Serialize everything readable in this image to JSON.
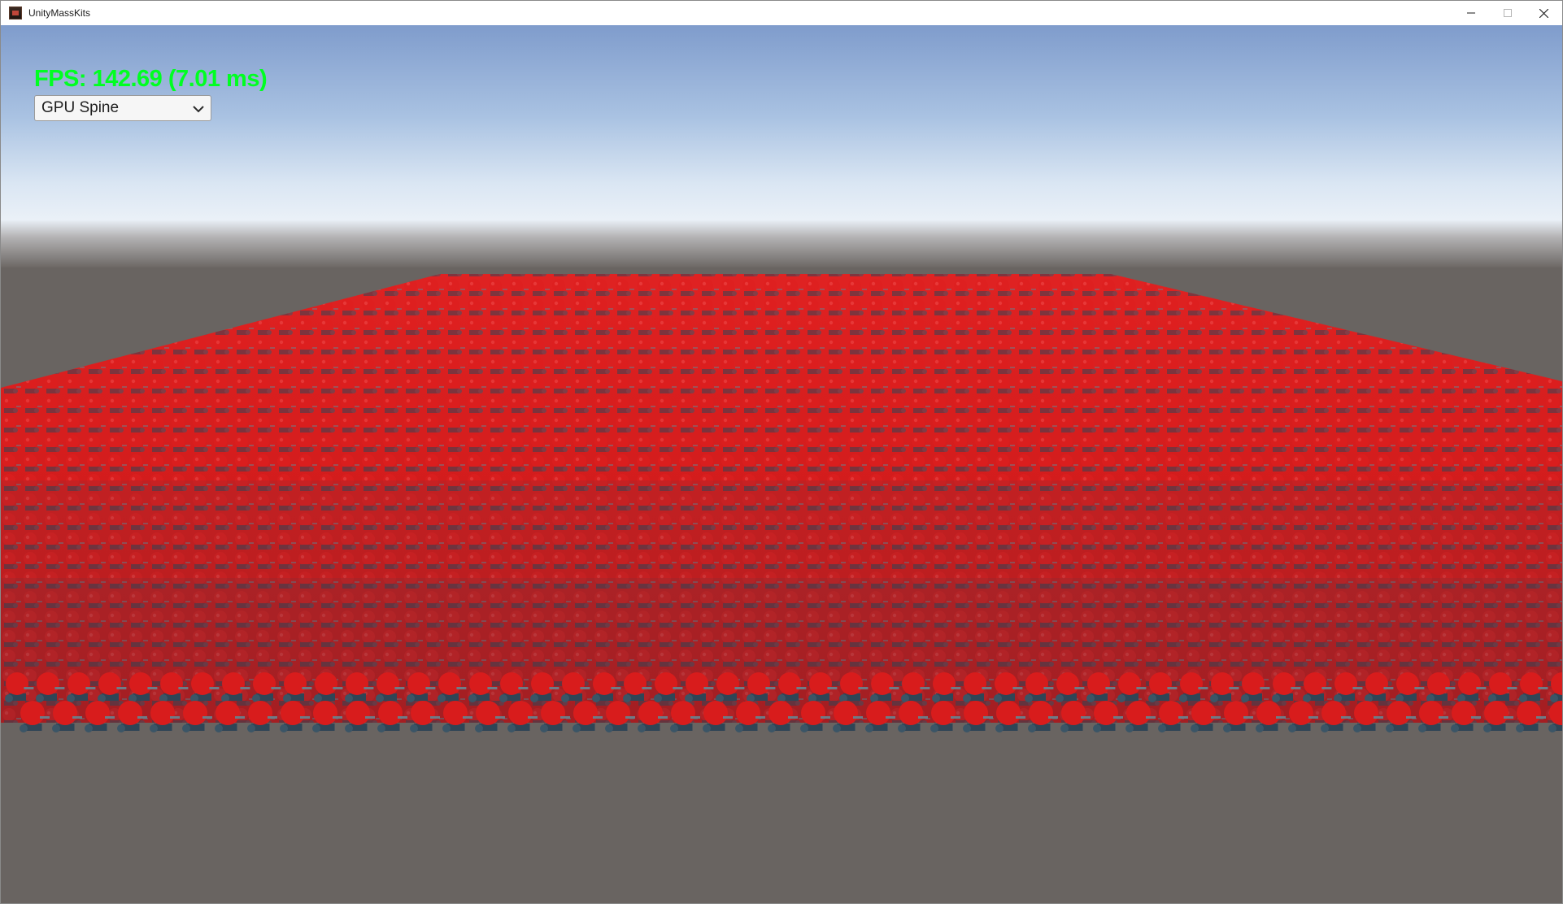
{
  "window": {
    "title": "UnityMassKits",
    "controls": {
      "minimize_icon": "minimize-icon",
      "maximize_icon": "maximize-icon",
      "close_icon": "close-icon"
    }
  },
  "hud": {
    "fps_text": "FPS: 142.69 (7.01 ms)",
    "fps_color": "#00ff21"
  },
  "render_mode_dropdown": {
    "selected": "GPU Spine",
    "icon": "chevron-down-icon"
  },
  "scene": {
    "sky_top_color": "#7f9ccc",
    "sky_horizon_color": "#e9f2fb",
    "ground_color": "#696461",
    "unit_head_color": "#d81c1c",
    "unit_armor_color": "#2f4556",
    "unit_sword_color": "#6f7b86"
  }
}
